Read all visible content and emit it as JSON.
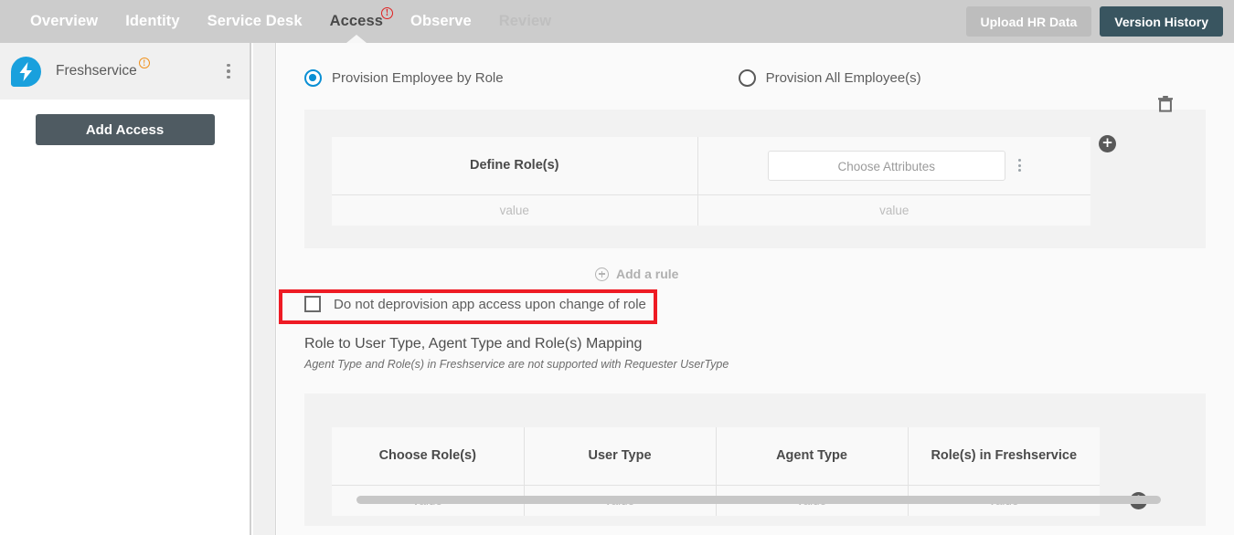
{
  "topbar": {
    "tabs": [
      {
        "label": "Overview",
        "state": "normal"
      },
      {
        "label": "Identity",
        "state": "normal"
      },
      {
        "label": "Service Desk",
        "state": "normal"
      },
      {
        "label": "Access",
        "state": "active",
        "badge": "!"
      },
      {
        "label": "Observe",
        "state": "normal"
      },
      {
        "label": "Review",
        "state": "muted"
      }
    ],
    "upload_label": "Upload HR Data",
    "version_label": "Version History"
  },
  "sidebar": {
    "app_name": "Freshservice",
    "app_badge": "!",
    "add_access_label": "Add Access"
  },
  "main": {
    "radios": [
      {
        "label": "Provision Employee by Role",
        "selected": true
      },
      {
        "label": "Provision All Employee(s)",
        "selected": false
      }
    ],
    "role_table": {
      "headers": [
        "Define Role(s)",
        "Choose Attributes"
      ],
      "attribute_button_label": "Choose Attributes",
      "rows": [
        [
          "value",
          "value"
        ]
      ]
    },
    "add_rule_label": "Add a rule",
    "checkbox": {
      "label": "Do not deprovision app access upon change of role",
      "checked": false
    },
    "mapping": {
      "title": "Role to User Type, Agent Type and Role(s) Mapping",
      "subtitle": "Agent Type and Role(s) in Freshservice are not supported with Requester UserType",
      "headers": [
        "Choose Role(s)",
        "User Type",
        "Agent Type",
        "Role(s) in Freshservice"
      ],
      "rows": [
        [
          "value",
          "value",
          "value",
          "value"
        ]
      ]
    }
  },
  "colors": {
    "header_bg": "#cccccc",
    "accent_blue": "#0a8fd4",
    "version_btn": "#395560",
    "add_access_btn": "#4f5b62",
    "warn_red": "#e02020",
    "warn_orange": "#f0921e",
    "annotation_red": "#ee1b24"
  }
}
